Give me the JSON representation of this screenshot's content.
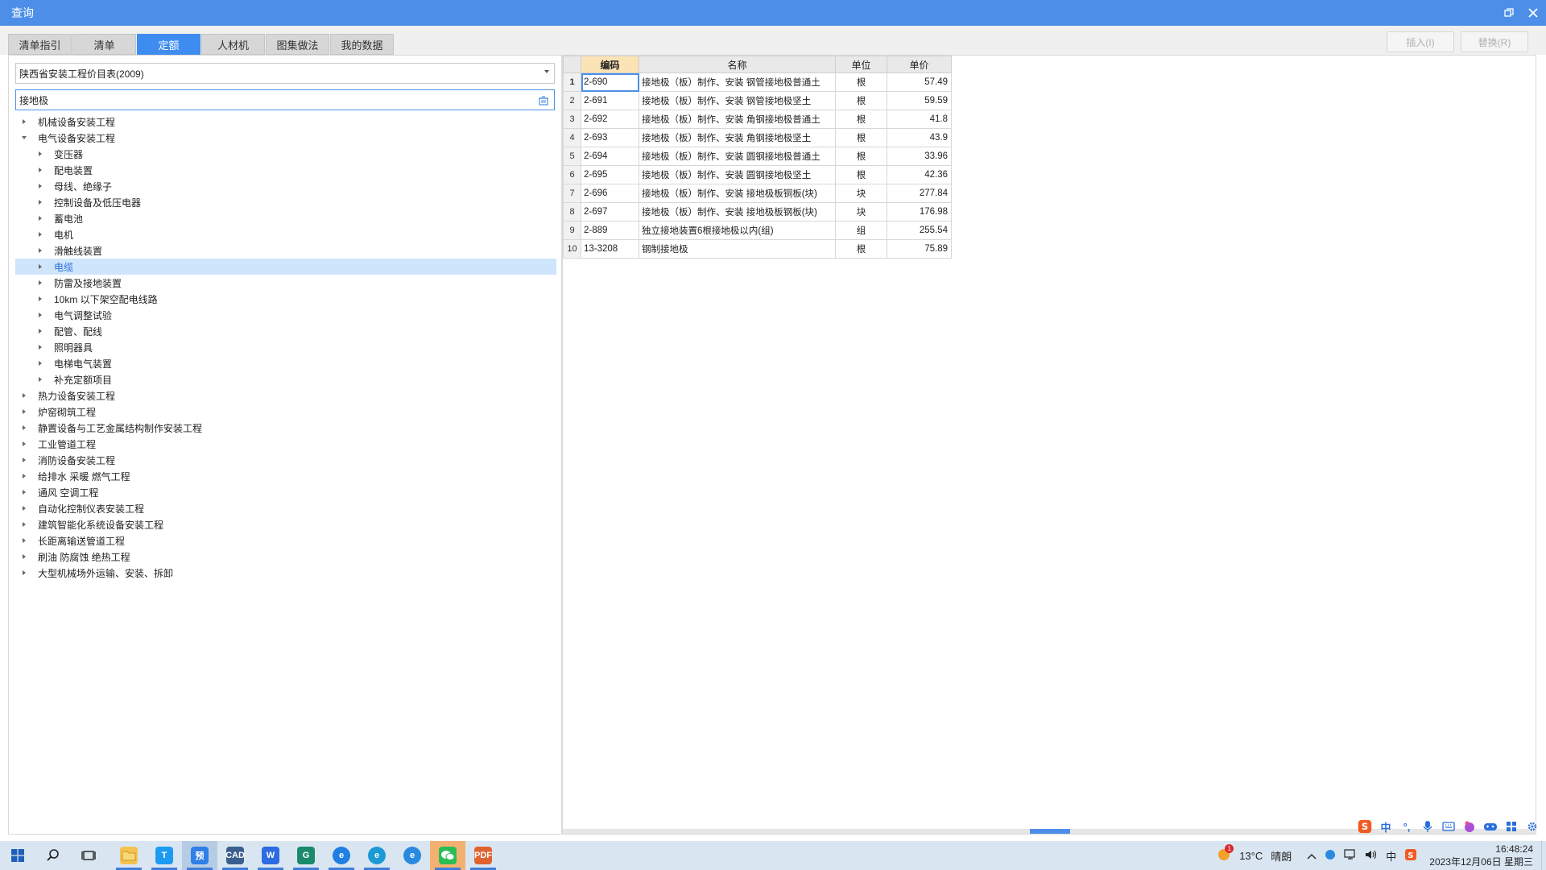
{
  "window": {
    "title": "查询"
  },
  "tabs": [
    {
      "label": "清单指引"
    },
    {
      "label": "清单"
    },
    {
      "label": "定额",
      "active": true
    },
    {
      "label": "人材机"
    },
    {
      "label": "图集做法"
    },
    {
      "label": "我的数据"
    }
  ],
  "actions": {
    "insert_label": "插入(I)",
    "replace_label": "替换(R)"
  },
  "library": {
    "selected": "陕西省安装工程价目表(2009)"
  },
  "search": {
    "value": "接地极"
  },
  "tree": [
    {
      "label": "机械设备安装工程",
      "level": 0,
      "expanded": false
    },
    {
      "label": "电气设备安装工程",
      "level": 0,
      "expanded": true
    },
    {
      "label": "变压器",
      "level": 1
    },
    {
      "label": "配电装置",
      "level": 1
    },
    {
      "label": "母线、绝缘子",
      "level": 1
    },
    {
      "label": "控制设备及低压电器",
      "level": 1
    },
    {
      "label": "蓄电池",
      "level": 1
    },
    {
      "label": "电机",
      "level": 1
    },
    {
      "label": "滑触线装置",
      "level": 1
    },
    {
      "label": "电缆",
      "level": 1,
      "selected": true
    },
    {
      "label": "防雷及接地装置",
      "level": 1
    },
    {
      "label": "10km 以下架空配电线路",
      "level": 1
    },
    {
      "label": "电气调整试验",
      "level": 1
    },
    {
      "label": "配管、配线",
      "level": 1
    },
    {
      "label": "照明器具",
      "level": 1
    },
    {
      "label": "电梯电气装置",
      "level": 1
    },
    {
      "label": "补充定额项目",
      "level": 1
    },
    {
      "label": "热力设备安装工程",
      "level": 0
    },
    {
      "label": "炉窑砌筑工程",
      "level": 0
    },
    {
      "label": "静置设备与工艺金属结构制作安装工程",
      "level": 0
    },
    {
      "label": "工业管道工程",
      "level": 0
    },
    {
      "label": "消防设备安装工程",
      "level": 0
    },
    {
      "label": "给排水 采暖 燃气工程",
      "level": 0
    },
    {
      "label": "通风 空调工程",
      "level": 0
    },
    {
      "label": "自动化控制仪表安装工程",
      "level": 0
    },
    {
      "label": "建筑智能化系统设备安装工程",
      "level": 0
    },
    {
      "label": "长距离输送管道工程",
      "level": 0
    },
    {
      "label": "刷油 防腐蚀 绝热工程",
      "level": 0
    },
    {
      "label": "大型机械场外运输、安装、拆卸",
      "level": 0
    }
  ],
  "table": {
    "headers": {
      "code": "编码",
      "name": "名称",
      "unit": "单位",
      "price": "单价"
    },
    "rows": [
      {
        "n": "1",
        "code": "2-690",
        "name": "接地极（板）制作、安装 钢管接地极普通土",
        "unit": "根",
        "price": "57.49"
      },
      {
        "n": "2",
        "code": "2-691",
        "name": "接地极（板）制作、安装 钢管接地极坚土",
        "unit": "根",
        "price": "59.59"
      },
      {
        "n": "3",
        "code": "2-692",
        "name": "接地极（板）制作、安装 角钢接地极普通土",
        "unit": "根",
        "price": "41.8"
      },
      {
        "n": "4",
        "code": "2-693",
        "name": "接地极（板）制作、安装 角钢接地极坚土",
        "unit": "根",
        "price": "43.9"
      },
      {
        "n": "5",
        "code": "2-694",
        "name": "接地极（板）制作、安装 圆钢接地极普通土",
        "unit": "根",
        "price": "33.96"
      },
      {
        "n": "6",
        "code": "2-695",
        "name": "接地极（板）制作、安装 圆钢接地极坚土",
        "unit": "根",
        "price": "42.36"
      },
      {
        "n": "7",
        "code": "2-696",
        "name": "接地极（板）制作、安装 接地极板铜板(块)",
        "unit": "块",
        "price": "277.84"
      },
      {
        "n": "8",
        "code": "2-697",
        "name": "接地极（板）制作、安装 接地极板钢板(块)",
        "unit": "块",
        "price": "176.98"
      },
      {
        "n": "9",
        "code": "2-889",
        "name": "独立接地装置6根接地极以内(组)",
        "unit": "组",
        "price": "255.54"
      },
      {
        "n": "10",
        "code": "13-3208",
        "name": "钢制接地极",
        "unit": "根",
        "price": "75.89"
      }
    ]
  },
  "ime": {
    "mode_label": "中"
  },
  "taskbar": {
    "weather_temp": "13°C",
    "weather_text": "晴朗",
    "time": "16:48:24",
    "date": "2023年12月06日 星期三",
    "ime_tray": "中",
    "weather_badge": "1"
  },
  "colors": {
    "accent": "#3f8cf0",
    "titlebar": "#4d8fe8",
    "selected_row": "#cfe5fb",
    "active_header": "#fce3b5"
  }
}
